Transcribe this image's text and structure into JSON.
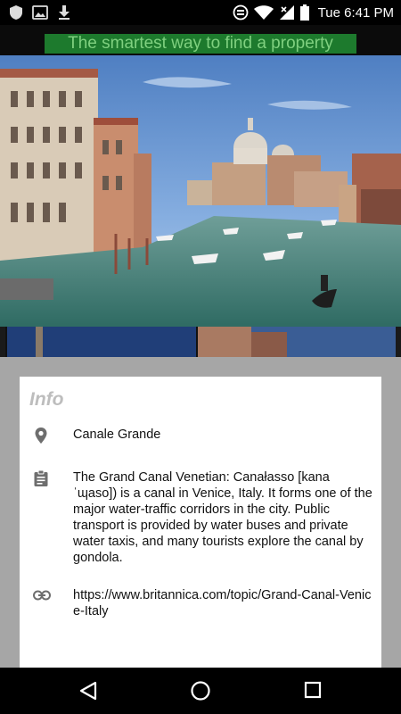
{
  "status_bar": {
    "time": "Tue 6:41 PM",
    "left_icons": [
      "shield-icon",
      "image-icon",
      "download-icon"
    ],
    "right_icons": [
      "sync-icon",
      "wifi-icon",
      "signal-icon",
      "battery-icon"
    ]
  },
  "banner": {
    "text": "The smartest way to find a property",
    "color": "#1d7a2d"
  },
  "info": {
    "title": "Info",
    "name": "Canale Grande",
    "description": "The Grand Canal Venetian: Canałasso [kanaˈɰaso]) is a canal in Venice, Italy. It forms one of the major water-traffic corridors in the city. Public transport is provided by water buses and private water taxis, and many tourists explore the canal by gondola.",
    "link": "https://www.britannica.com/topic/Grand-Canal-Venice-Italy"
  },
  "nav_bar": {
    "buttons": [
      "back-button",
      "home-button",
      "recents-button"
    ]
  }
}
